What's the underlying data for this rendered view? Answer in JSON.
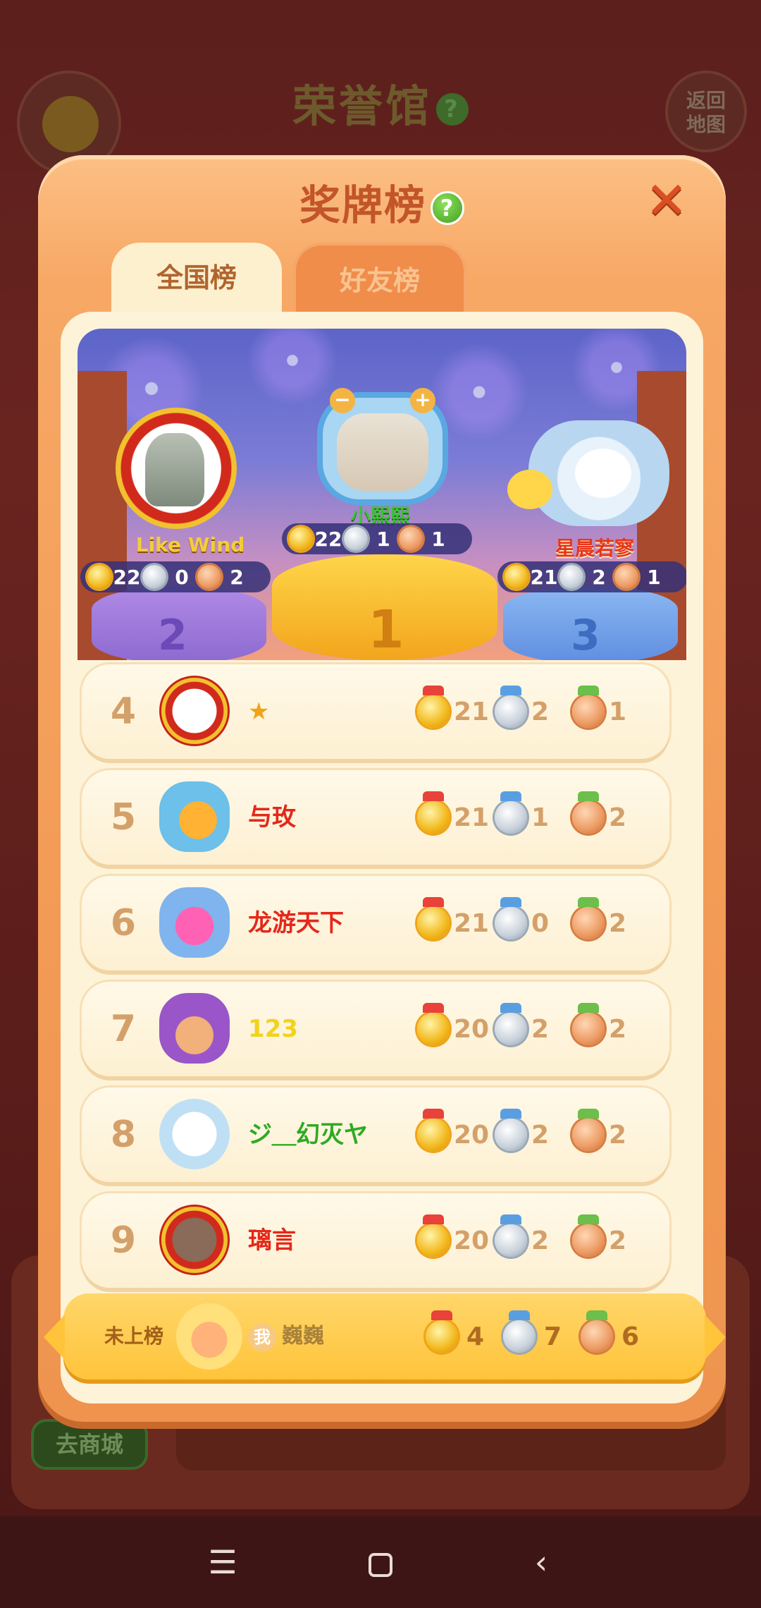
{
  "background": {
    "title": "荣誉馆",
    "back_to_map": "返回\n地图",
    "shop_button": "去商城"
  },
  "modal": {
    "title": "奖牌榜",
    "help_icon": "question-icon",
    "close_icon": "close-x-icon",
    "tabs": [
      {
        "label": "全国榜",
        "active": true
      },
      {
        "label": "好友榜",
        "active": false
      }
    ]
  },
  "podium": [
    {
      "place": "1",
      "name": "小熙熙",
      "gold": "22",
      "silver": "1",
      "bronze": "1"
    },
    {
      "place": "2",
      "name": "Like Wind",
      "gold": "22",
      "silver": "0",
      "bronze": "2"
    },
    {
      "place": "3",
      "name": "星晨若寥",
      "gold": "21",
      "silver": "2",
      "bronze": "1"
    }
  ],
  "rankings": [
    {
      "rank": "4",
      "name": "★",
      "name_color": "#f0a318",
      "gold": "21",
      "silver": "2",
      "bronze": "1"
    },
    {
      "rank": "5",
      "name": "与玫",
      "name_color": "#e4281a",
      "gold": "21",
      "silver": "1",
      "bronze": "2"
    },
    {
      "rank": "6",
      "name": "龙游天下",
      "name_color": "#e4281a",
      "gold": "21",
      "silver": "0",
      "bronze": "2"
    },
    {
      "rank": "7",
      "name": "123",
      "name_color": "#f2d21c",
      "gold": "20",
      "silver": "2",
      "bronze": "2"
    },
    {
      "rank": "8",
      "name": "ジ＿幻灭ヤ",
      "name_color": "#2faa22",
      "gold": "20",
      "silver": "2",
      "bronze": "2"
    },
    {
      "rank": "9",
      "name": "璃言",
      "name_color": "#e4281a",
      "gold": "20",
      "silver": "2",
      "bronze": "2"
    }
  ],
  "me": {
    "status": "未上榜",
    "badge": "我",
    "name": "巍巍",
    "gold": "4",
    "silver": "7",
    "bronze": "6"
  },
  "system_nav": {
    "menu": "☰",
    "back": "‹"
  }
}
